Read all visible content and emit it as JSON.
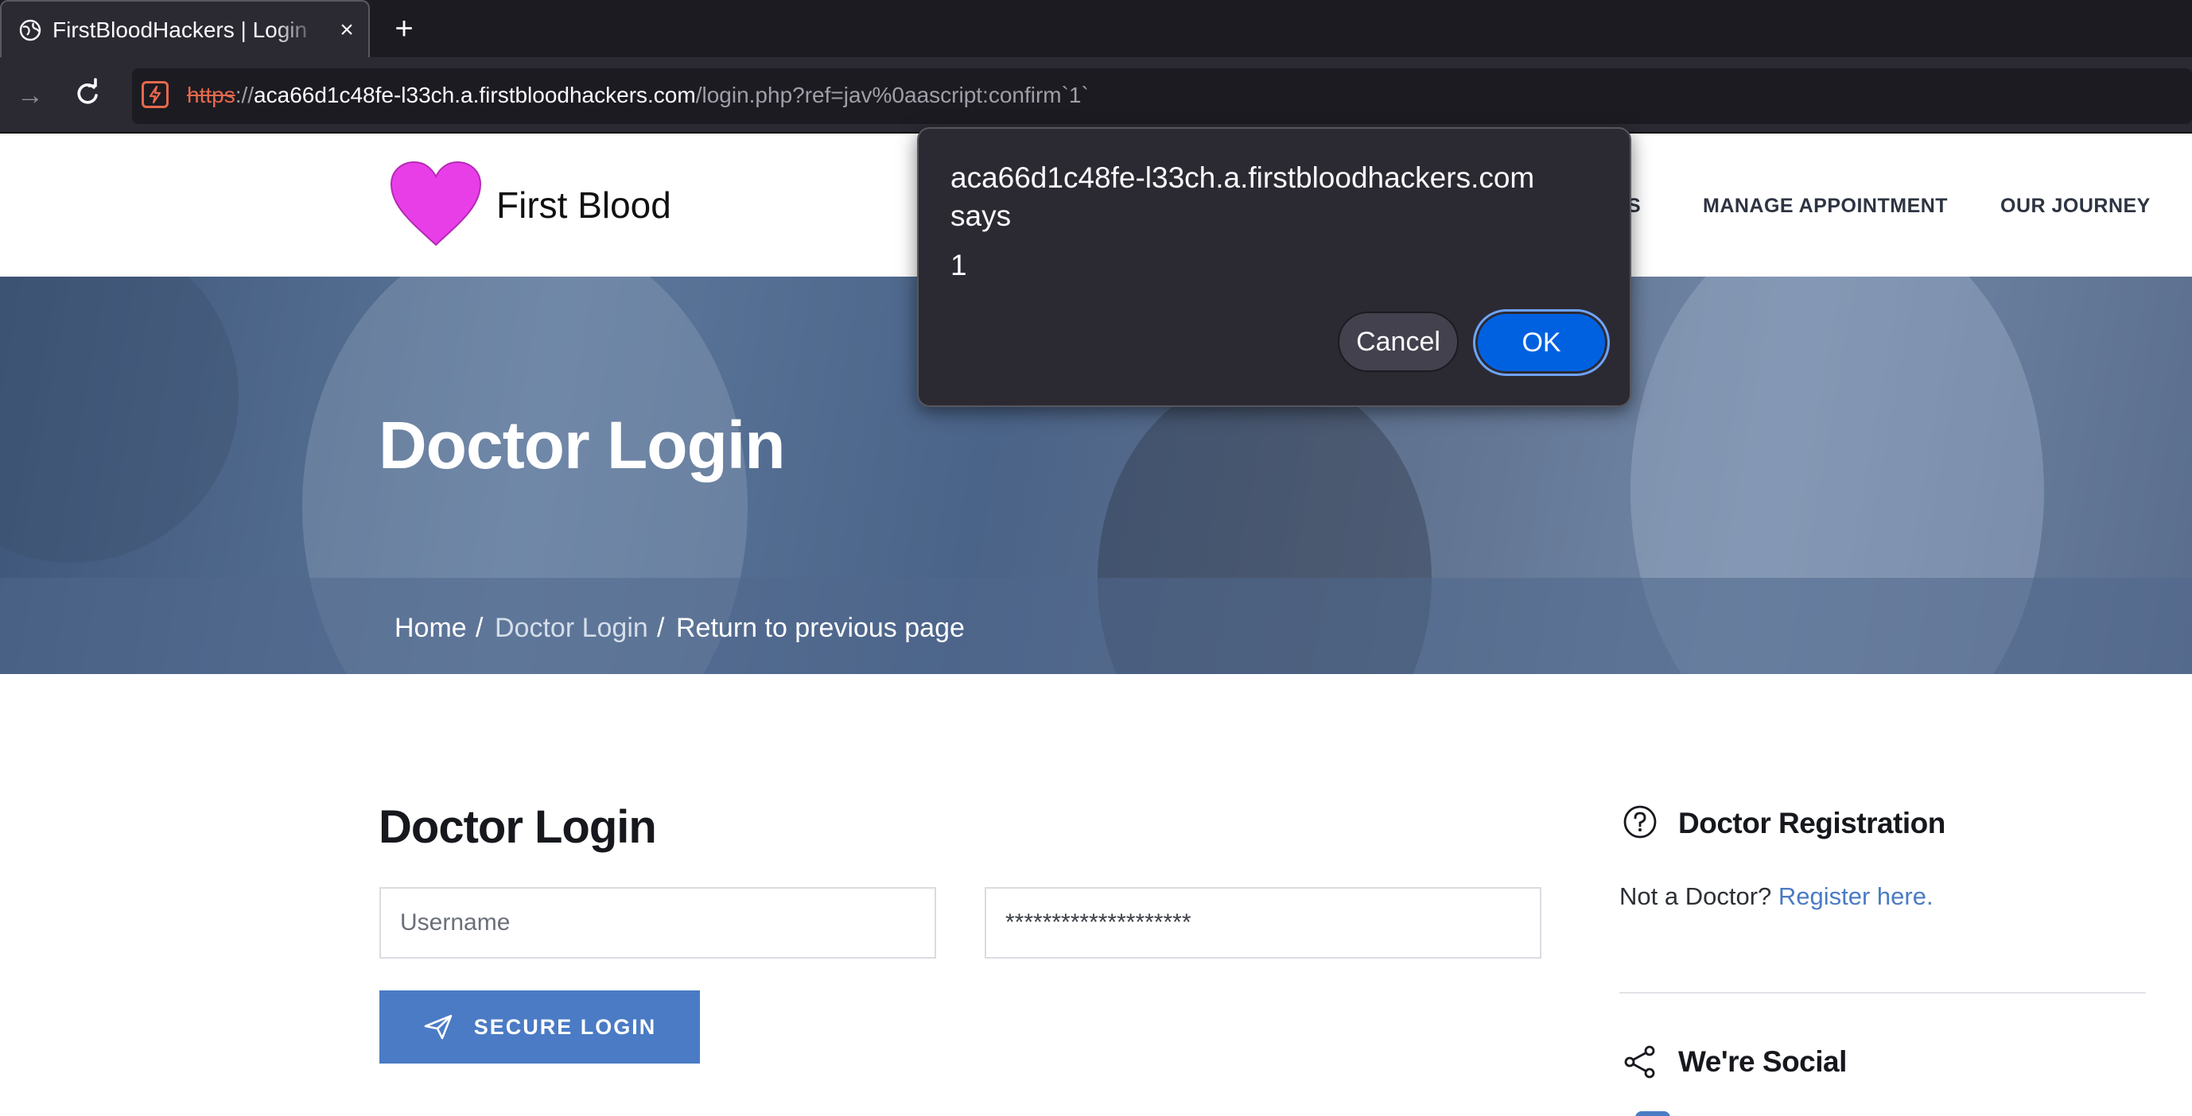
{
  "browser": {
    "tab_title": "FirstBloodHackers | Login",
    "tab_close_glyph": "×",
    "new_tab_glyph": "+",
    "url_scheme": "https",
    "url_sep": "://",
    "url_host": "aca66d1c48fe-l33ch.a.firstbloodhackers.com",
    "url_path": "/login.php?ref=jav%0aascript:confirm`1`"
  },
  "site": {
    "brand": "First Blood",
    "menu": [
      "S",
      "MANAGE APPOINTMENT",
      "OUR JOURNEY"
    ]
  },
  "hero": {
    "title": "Doctor Login",
    "breadcrumb": {
      "home": "Home",
      "sep": "/",
      "current": "Doctor Login",
      "return": "Return to previous page"
    }
  },
  "form": {
    "title": "Doctor Login",
    "username_placeholder": "Username",
    "password_value": "********************",
    "submit_label": "SECURE LOGIN"
  },
  "sidebar": {
    "registration_title": "Doctor Registration",
    "not_doctor_text": "Not a Doctor?",
    "register_link": "Register here.",
    "social_title": "We're Social"
  },
  "dialog": {
    "message": "aca66d1c48fe-l33ch.a.firstbloodhackers.com says",
    "value": "1",
    "cancel_label": "Cancel",
    "ok_label": "OK"
  },
  "colors": {
    "accent": "#4a7bc4",
    "heart": "#e83ee8",
    "dialog_ok": "#0061e0"
  }
}
